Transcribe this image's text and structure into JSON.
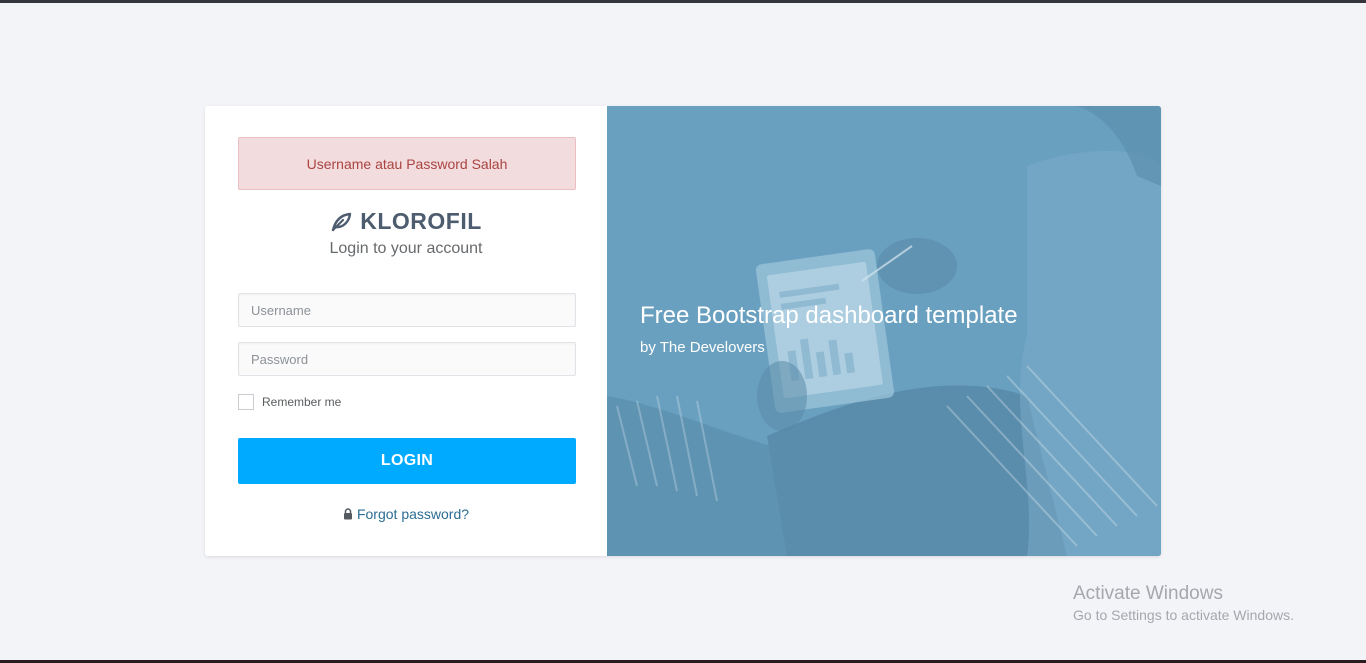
{
  "alert": {
    "message": "Username atau Password Salah"
  },
  "brand": {
    "name": "KLOROFIL",
    "icon": "leaf-icon"
  },
  "login": {
    "subtitle": "Login to your account",
    "username_placeholder": "Username",
    "username_value": "",
    "password_placeholder": "Password",
    "password_value": "",
    "remember_label": "Remember me",
    "remember_checked": false,
    "button_label": "LOGIN",
    "forgot_label": "Forgot password?",
    "forgot_icon": "lock-icon"
  },
  "hero": {
    "title": "Free Bootstrap dashboard template",
    "byline": "by The Develovers"
  },
  "watermark": {
    "title": "Activate Windows",
    "subtitle": "Go to Settings to activate Windows."
  },
  "colors": {
    "accent": "#00aaff",
    "alert_bg": "#f3dcdd",
    "alert_text": "#a94442",
    "hero_overlay": "#6aa0bf",
    "page_bg": "#f3f4f8"
  }
}
